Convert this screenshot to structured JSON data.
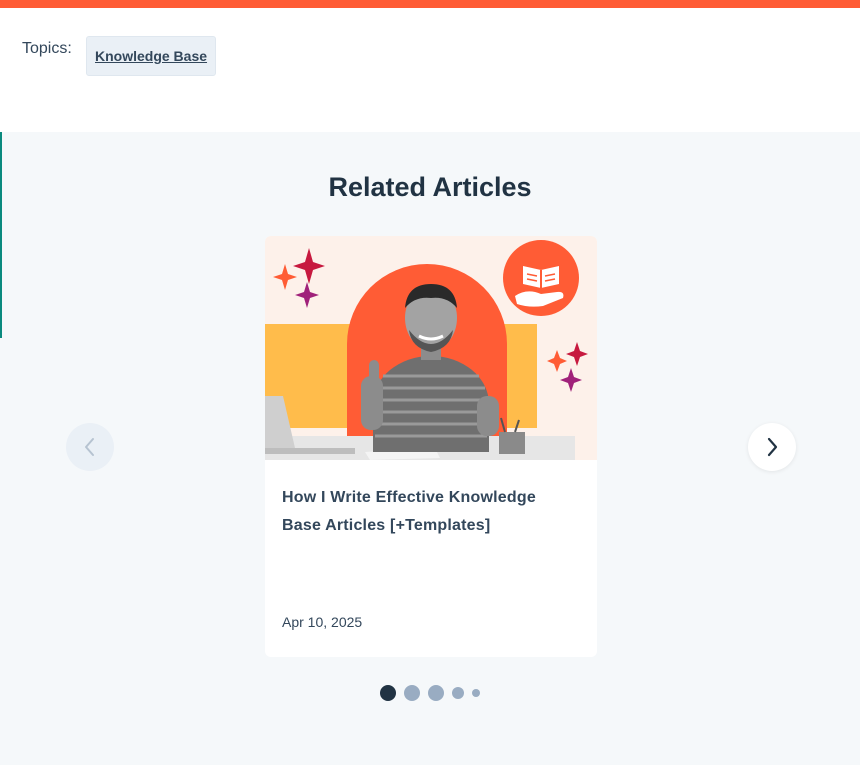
{
  "colors": {
    "top_bar": "#ff5c35",
    "left_rail_top": "#5f6b7a",
    "left_rail_teal": "#00a4bd",
    "section_bg": "#f5f8fa",
    "dot_active": "#213343",
    "dot_inactive": "#99acc2"
  },
  "topics": {
    "label": "Topics:",
    "tags": [
      "Knowledge Base"
    ]
  },
  "related": {
    "title": "Related Articles",
    "cards": [
      {
        "title": "How I Write Effective Knowledge Base Articles [+Templates]",
        "date": "Apr 10, 2025",
        "image_icon": "open-book-hand-icon"
      }
    ]
  },
  "carousel": {
    "prev_icon": "chevron-left-icon",
    "next_icon": "chevron-right-icon",
    "dot_count": 5,
    "active_dot_index": 0
  }
}
